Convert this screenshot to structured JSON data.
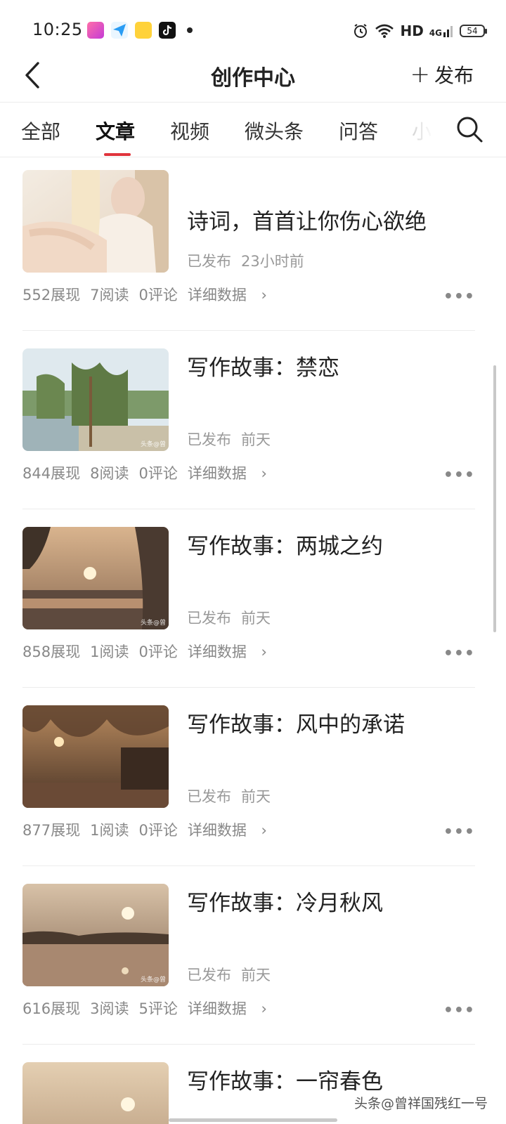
{
  "status_bar": {
    "time": "10:25",
    "network": "HD",
    "signal": "4G",
    "battery": "54",
    "icons": [
      "app-icon-1",
      "send-icon",
      "app-icon-2",
      "tiktok-icon",
      "alarm-icon",
      "wifi-icon"
    ]
  },
  "header": {
    "title": "创作中心",
    "publish_label": "发布"
  },
  "tabs": [
    {
      "label": "全部"
    },
    {
      "label": "文章"
    },
    {
      "label": "视频"
    },
    {
      "label": "微头条"
    },
    {
      "label": "问答"
    },
    {
      "label": "小"
    }
  ],
  "accent_color": "#e0343c",
  "articles": [
    {
      "title": "诗词，首首让你伤心欲绝",
      "status": "已发布",
      "time": "23小时前",
      "impressions": "552展现",
      "reads": "7阅读",
      "comments": "0评论",
      "detail": "详细数据"
    },
    {
      "title": "写作故事：禁恋",
      "status": "已发布",
      "time": "前天",
      "impressions": "844展现",
      "reads": "8阅读",
      "comments": "0评论",
      "detail": "详细数据",
      "watermark": "头条@曾"
    },
    {
      "title": "写作故事：两城之约",
      "status": "已发布",
      "time": "前天",
      "impressions": "858展现",
      "reads": "1阅读",
      "comments": "0评论",
      "detail": "详细数据",
      "watermark": "头条@曾"
    },
    {
      "title": "写作故事：风中的承诺",
      "status": "已发布",
      "time": "前天",
      "impressions": "877展现",
      "reads": "1阅读",
      "comments": "0评论",
      "detail": "详细数据"
    },
    {
      "title": "写作故事：冷月秋风",
      "status": "已发布",
      "time": "前天",
      "impressions": "616展现",
      "reads": "3阅读",
      "comments": "5评论",
      "detail": "详细数据",
      "watermark": "头条@曾"
    },
    {
      "title": "写作故事：一帘春色"
    }
  ],
  "watermark": "头条@曾祥国残红一号"
}
